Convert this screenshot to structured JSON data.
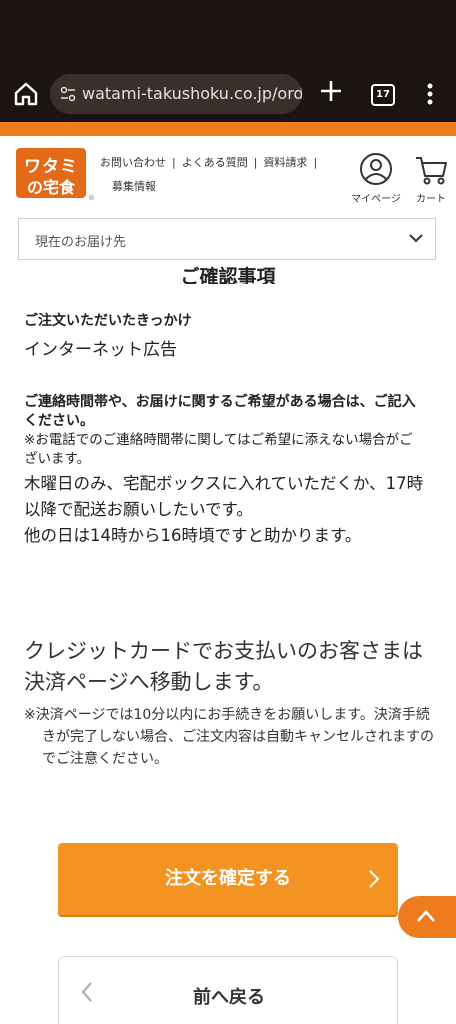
{
  "browser": {
    "url": "watami-takushoku.co.jp/orde",
    "tab_count": "17"
  },
  "header": {
    "logo_top": "ワタミ",
    "logo_bottom": "の宅食",
    "logo_mark": "®",
    "nav": {
      "contact": "お問い合わせ",
      "faq": "よくある質問",
      "brochure": "資料請求",
      "recruit": "募集情報",
      "separator": "|"
    },
    "mypage": "マイページ",
    "cart": "カート"
  },
  "delivery": {
    "label": "現在のお届け先"
  },
  "section_title": "ご確認事項",
  "order_reason": {
    "question": "ご注文いただいたきっかけ",
    "answer": "インターネット広告"
  },
  "contact_request": {
    "question": "ご連絡時間帯や、お届けに関するご希望がある場合は、ご記入ください。",
    "note": "※お電話でのご連絡時間帯に関してはご希望に添えない場合がございます。",
    "answer_line1": "木曜日のみ、宅配ボックスに入れていただくか、17時以降で配送お願いしたいです。",
    "answer_line2": "他の日は14時から16時頃ですと助かります。"
  },
  "payment": {
    "notice": "クレジットカードでお支払いのお客さまは決済ページへ移動します。",
    "note": "※決済ページでは10分以内にお手続きをお願いします。決済手続きが完了しない場合、ご注文内容は自動キャンセルされますのでご注意ください。"
  },
  "buttons": {
    "confirm": "注文を確定する",
    "back": "前へ戻る"
  },
  "colors": {
    "brand_orange": "#ee7c1f",
    "button_orange": "#f39422",
    "browser_dark": "#1c1410"
  }
}
